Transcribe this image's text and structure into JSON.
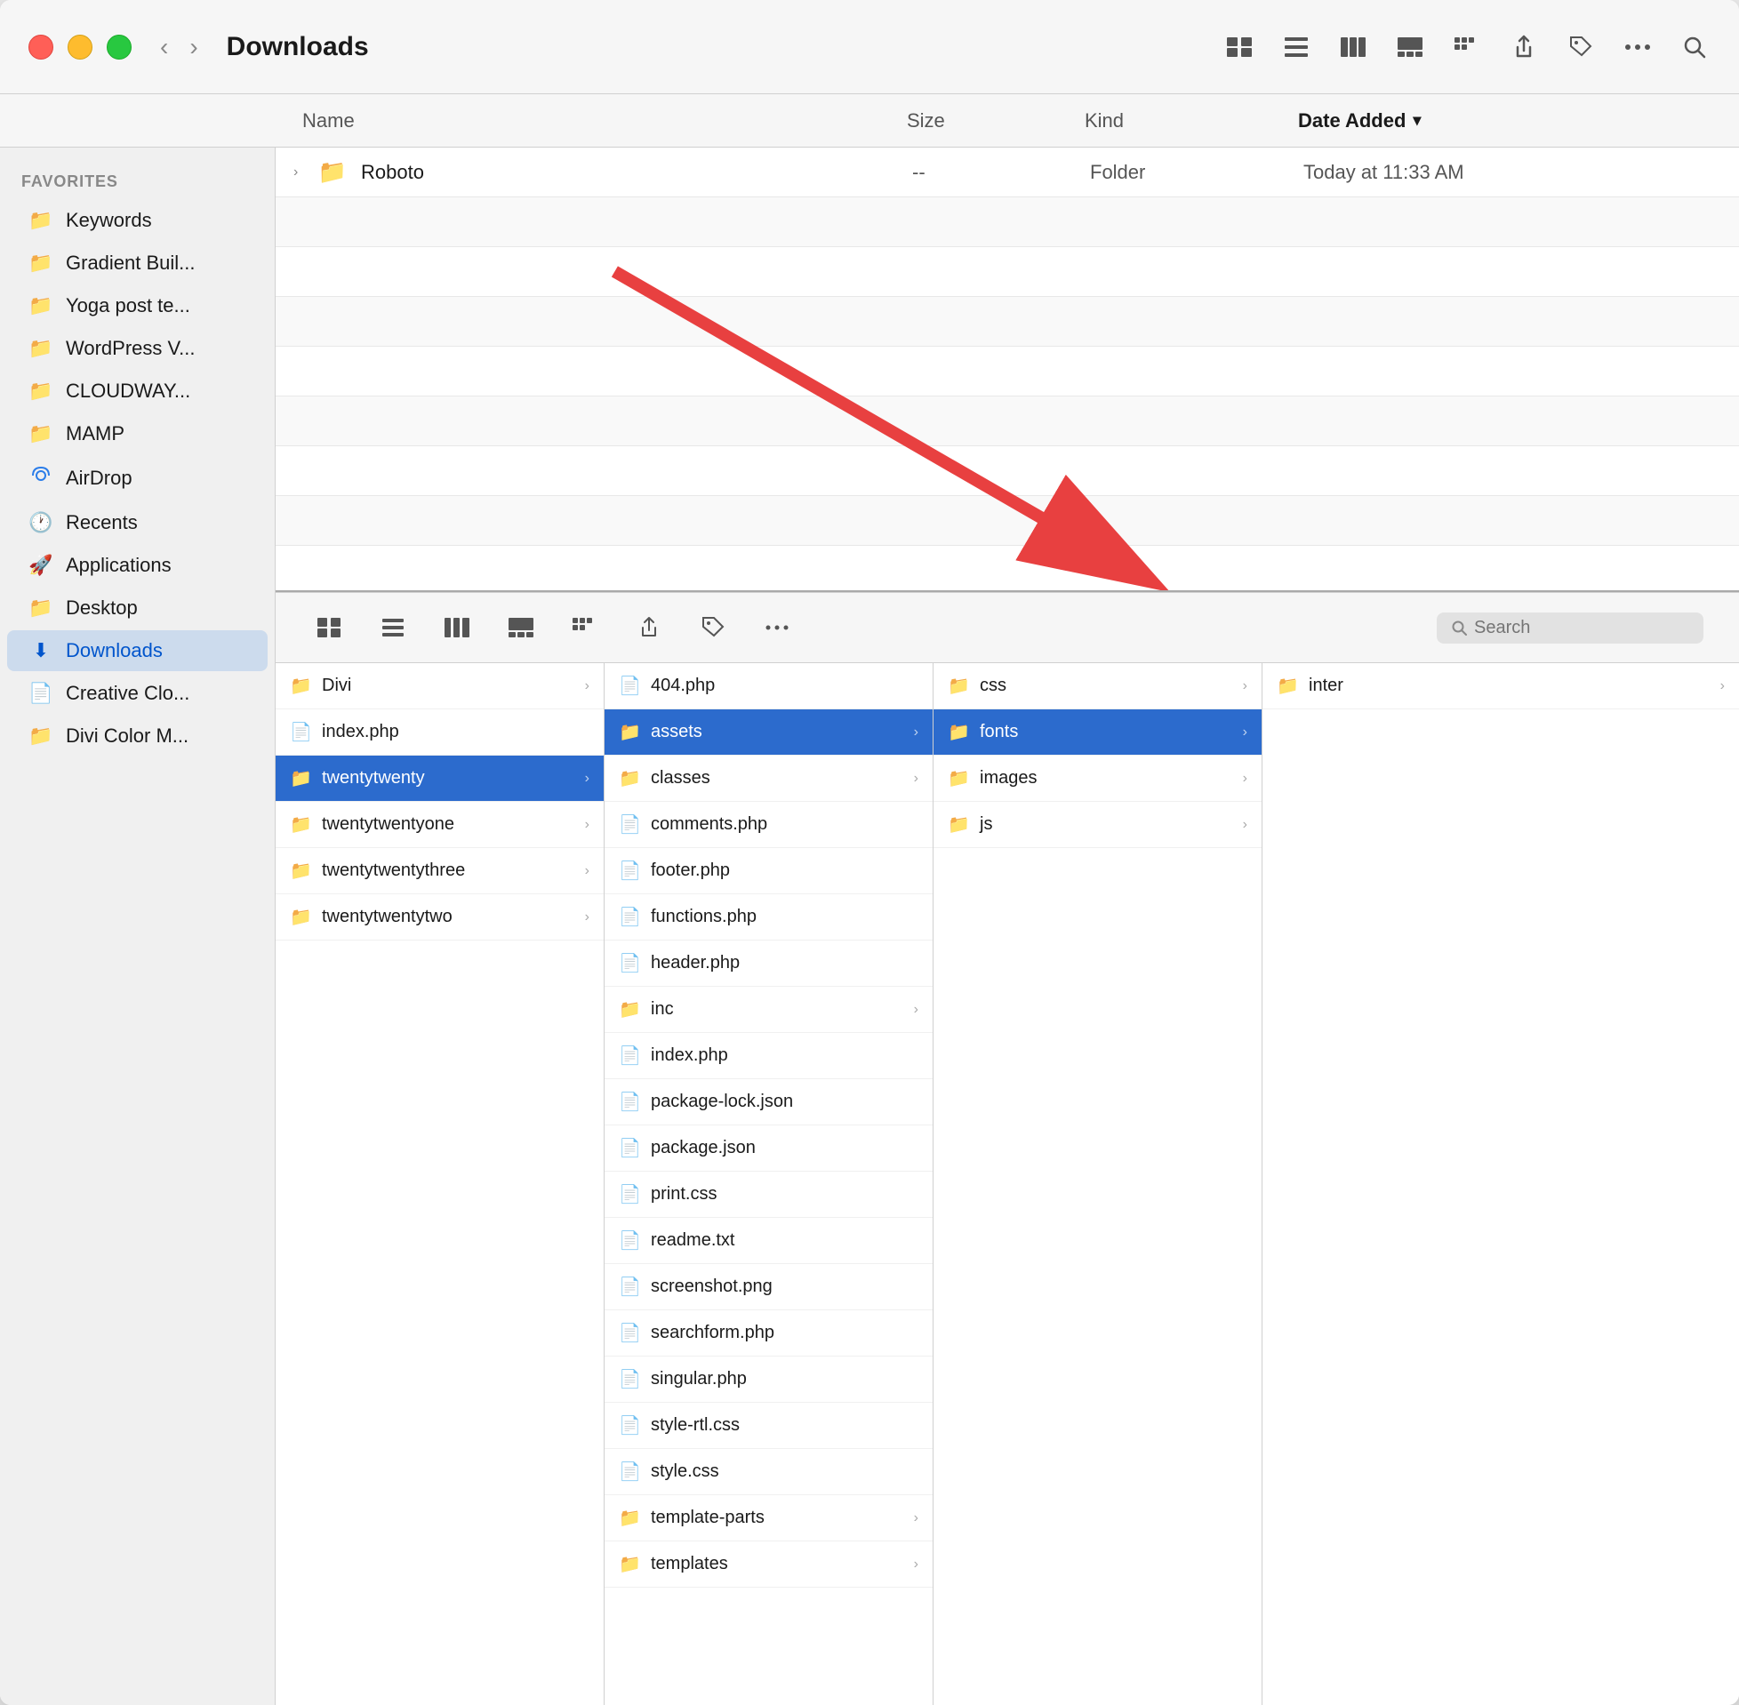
{
  "window": {
    "title": "Downloads",
    "traffic_lights": [
      "red",
      "yellow",
      "green"
    ]
  },
  "toolbar": {
    "back_label": "‹",
    "forward_label": "›",
    "title": "Downloads",
    "view_icons": [
      "⊞",
      "☰",
      "⊟",
      "⊡"
    ],
    "action_icons": [
      "⬆",
      "◇",
      "⊙"
    ]
  },
  "columns": {
    "name": "Name",
    "size": "Size",
    "kind": "Kind",
    "date_added": "Date Added"
  },
  "top_file": {
    "name": "Roboto",
    "size": "--",
    "kind": "Folder",
    "date_added": "Today at 11:33 AM"
  },
  "sidebar": {
    "section_label": "Favorites",
    "items": [
      {
        "id": "keywords",
        "label": "Keywords",
        "icon": "📁"
      },
      {
        "id": "gradient-buil",
        "label": "Gradient Buil...",
        "icon": "📁"
      },
      {
        "id": "yoga-post-te",
        "label": "Yoga post te...",
        "icon": "📁"
      },
      {
        "id": "wordpress-v",
        "label": "WordPress V...",
        "icon": "📁"
      },
      {
        "id": "cloudway",
        "label": "CLOUDWAY...",
        "icon": "📁"
      },
      {
        "id": "mamp",
        "label": "MAMP",
        "icon": "📁"
      },
      {
        "id": "airdrop",
        "label": "AirDrop",
        "icon": "📡"
      },
      {
        "id": "recents",
        "label": "Recents",
        "icon": "🕐"
      },
      {
        "id": "applications",
        "label": "Applications",
        "icon": "🚀"
      },
      {
        "id": "desktop",
        "label": "Desktop",
        "icon": "📁"
      },
      {
        "id": "downloads",
        "label": "Downloads",
        "icon": "📥",
        "active": true
      },
      {
        "id": "creative-clo",
        "label": "Creative Clo...",
        "icon": "📄"
      },
      {
        "id": "divi-color-m",
        "label": "Divi Color M...",
        "icon": "📁"
      }
    ]
  },
  "column_browser": {
    "col1": {
      "items": [
        {
          "id": "divi",
          "name": "Divi",
          "type": "folder",
          "has_children": true
        },
        {
          "id": "index-php-1",
          "name": "index.php",
          "type": "file",
          "has_children": false
        },
        {
          "id": "twentytwenty",
          "name": "twentytwenty",
          "type": "folder",
          "has_children": true,
          "selected": true
        },
        {
          "id": "twentytwentyone",
          "name": "twentytwentyone",
          "type": "folder",
          "has_children": true
        },
        {
          "id": "twentytwentythree",
          "name": "twentytwentythree",
          "type": "folder",
          "has_children": true
        },
        {
          "id": "twentytwentytwo",
          "name": "twentytwentytwo",
          "type": "folder",
          "has_children": true
        }
      ]
    },
    "col2": {
      "items": [
        {
          "id": "404-php",
          "name": "404.php",
          "type": "file",
          "has_children": false
        },
        {
          "id": "assets",
          "name": "assets",
          "type": "folder",
          "has_children": true,
          "selected": true
        },
        {
          "id": "classes",
          "name": "classes",
          "type": "folder",
          "has_children": true
        },
        {
          "id": "comments-php",
          "name": "comments.php",
          "type": "file",
          "has_children": false
        },
        {
          "id": "footer-php",
          "name": "footer.php",
          "type": "file",
          "has_children": false
        },
        {
          "id": "functions-php",
          "name": "functions.php",
          "type": "file",
          "has_children": false
        },
        {
          "id": "header-php",
          "name": "header.php",
          "type": "file",
          "has_children": false
        },
        {
          "id": "inc",
          "name": "inc",
          "type": "folder",
          "has_children": true
        },
        {
          "id": "index-php-2",
          "name": "index.php",
          "type": "file",
          "has_children": false
        },
        {
          "id": "package-lock-json",
          "name": "package-lock.json",
          "type": "file",
          "has_children": false
        },
        {
          "id": "package-json",
          "name": "package.json",
          "type": "file",
          "has_children": false
        },
        {
          "id": "print-css",
          "name": "print.css",
          "type": "file",
          "has_children": false
        },
        {
          "id": "readme-txt",
          "name": "readme.txt",
          "type": "file",
          "has_children": false
        },
        {
          "id": "screenshot-png",
          "name": "screenshot.png",
          "type": "file",
          "has_children": false
        },
        {
          "id": "searchform-php",
          "name": "searchform.php",
          "type": "file",
          "has_children": false
        },
        {
          "id": "singular-php",
          "name": "singular.php",
          "type": "file",
          "has_children": false
        },
        {
          "id": "style-rtl-css",
          "name": "style-rtl.css",
          "type": "file",
          "has_children": false
        },
        {
          "id": "style-css",
          "name": "style.css",
          "type": "file",
          "has_children": false
        },
        {
          "id": "template-parts",
          "name": "template-parts",
          "type": "folder",
          "has_children": true
        },
        {
          "id": "templates",
          "name": "templates",
          "type": "folder",
          "has_children": true
        }
      ]
    },
    "col3": {
      "items": [
        {
          "id": "css",
          "name": "css",
          "type": "folder",
          "has_children": true
        },
        {
          "id": "fonts",
          "name": "fonts",
          "type": "folder",
          "has_children": true,
          "selected": true
        },
        {
          "id": "images",
          "name": "images",
          "type": "folder",
          "has_children": true
        },
        {
          "id": "js",
          "name": "js",
          "type": "folder",
          "has_children": true
        }
      ]
    },
    "col4": {
      "items": [
        {
          "id": "inter",
          "name": "inter",
          "type": "folder",
          "has_children": true
        }
      ]
    }
  },
  "bottom_toolbar": {
    "search_placeholder": "Search"
  },
  "annotation": {
    "arrow_color": "#e84040"
  }
}
